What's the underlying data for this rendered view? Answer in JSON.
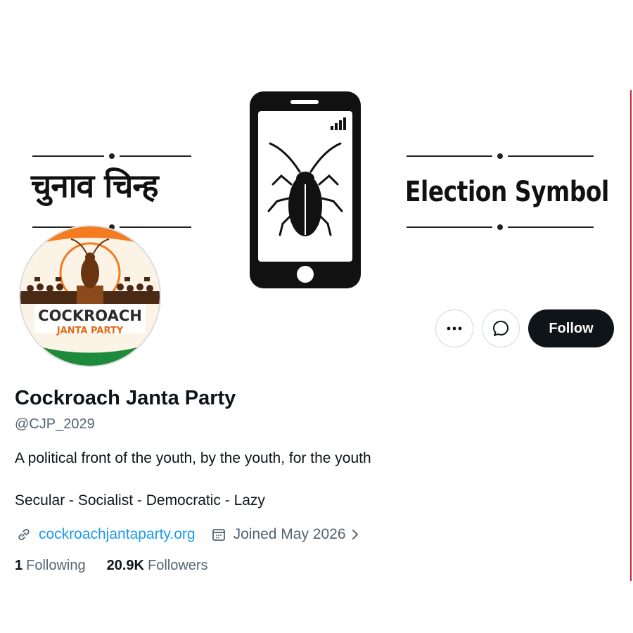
{
  "banner": {
    "hindi_text": "चुनाव चिन्ह",
    "english_text": "Election Symbol"
  },
  "avatar": {
    "logo_line1": "COCKROACH",
    "logo_line2": "JANTA PARTY"
  },
  "actions": {
    "follow_label": "Follow"
  },
  "profile": {
    "display_name": "Cockroach Janta Party",
    "handle": "@CJP_2029",
    "bio": "A political front of the youth, by the youth, for the youth",
    "tagline": "Secular - Socialist - Democratic - Lazy",
    "website": "cockroachjantaparty.org",
    "joined": "Joined May 2026"
  },
  "stats": {
    "following_count": "1",
    "following_label": "Following",
    "followers_count": "20.9K",
    "followers_label": "Followers"
  },
  "colors": {
    "link": "#1d9bf0",
    "secondary_text": "#536471",
    "primary_text": "#0f1419",
    "saffron": "#f47b20",
    "india_green": "#1e8a3b",
    "accent_rule": "#d8242b"
  },
  "icons": [
    "more-icon",
    "message-icon",
    "link-icon",
    "calendar-icon",
    "chevron-right-icon",
    "cockroach-icon",
    "signal-icon"
  ]
}
